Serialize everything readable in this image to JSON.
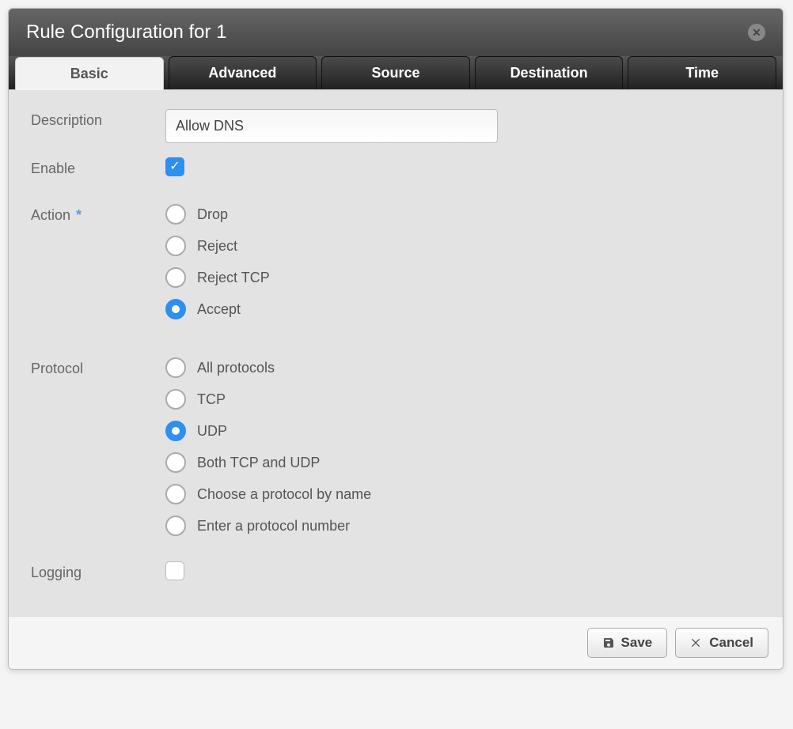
{
  "dialog": {
    "title": "Rule Configuration for 1"
  },
  "tabs": {
    "basic": "Basic",
    "advanced": "Advanced",
    "source": "Source",
    "destination": "Destination",
    "time": "Time",
    "active": "basic"
  },
  "labels": {
    "description": "Description",
    "enable": "Enable",
    "action": "Action",
    "protocol": "Protocol",
    "logging": "Logging"
  },
  "fields": {
    "description_value": "Allow DNS",
    "enable_checked": true,
    "logging_checked": false,
    "action_selected": "accept",
    "protocol_selected": "udp"
  },
  "options": {
    "action": {
      "drop": "Drop",
      "reject": "Reject",
      "reject_tcp": "Reject TCP",
      "accept": "Accept"
    },
    "protocol": {
      "all": "All protocols",
      "tcp": "TCP",
      "udp": "UDP",
      "both": "Both TCP and UDP",
      "byname": "Choose a protocol by name",
      "bynumber": "Enter a protocol number"
    }
  },
  "buttons": {
    "save": "Save",
    "cancel": "Cancel"
  }
}
